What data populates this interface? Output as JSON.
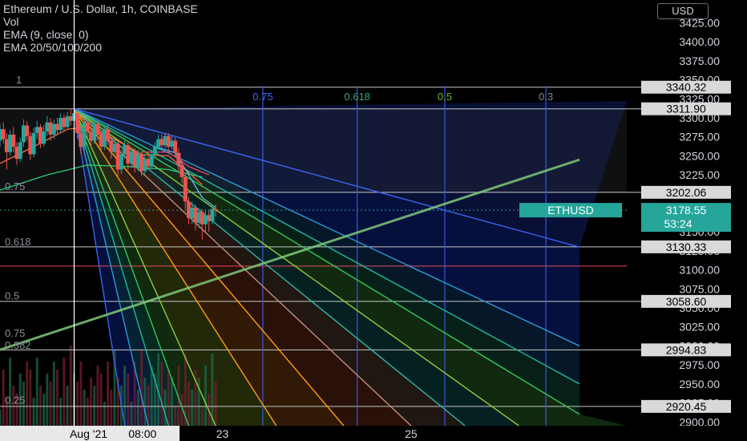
{
  "chart_data": {
    "type": "candlestick",
    "title": "Ethereum / U.S. Dollar, 1h, COINBASE",
    "indicators": [
      "Vol",
      "EMA (9, close, 0)",
      "EMA 20/50/100/200"
    ],
    "currency_button": "USD",
    "ylim": [
      2895,
      3455
    ],
    "y_ticks": [
      3425,
      3400,
      3375,
      3350,
      3325,
      3300,
      3275,
      3250,
      3225,
      3200,
      3175,
      3150,
      3125,
      3100,
      3075,
      3050,
      3025,
      3000,
      2975,
      2950,
      2925,
      2900
    ],
    "y_tick_labels": [
      "3425.00",
      "3400.00",
      "3375.00",
      "3350.00",
      "3325.00",
      "3300.00",
      "3275.00",
      "3250.00",
      "3225.00",
      "3200.00",
      "3175.00",
      "3150.00",
      "3125.00",
      "3100.00",
      "3075.00",
      "3050.00",
      "3025.00",
      "3000.00",
      "2975.00",
      "2950.00",
      "2925.00",
      "2900.00"
    ],
    "x_labels": [
      {
        "label": "Aug '21",
        "hour": 0,
        "highlight": true
      },
      {
        "label": "08:00",
        "hour": 8,
        "highlight": true
      },
      {
        "label": "23",
        "hour": 22
      },
      {
        "label": "25",
        "hour": 50
      }
    ],
    "x_range_hours": [
      -11,
      82
    ],
    "price_label": {
      "symbol": "ETHUSD",
      "price": "3178.55",
      "countdown": "53:24",
      "value": 3178.55
    },
    "horizontal_levels": [
      {
        "value": 3340.32,
        "label": "3340.32"
      },
      {
        "value": 3311.9,
        "label": "3311.90"
      },
      {
        "value": 3202.06,
        "label": "3202.06"
      },
      {
        "value": 3130.33,
        "label": "3130.33"
      },
      {
        "value": 3058.6,
        "label": "3058.60"
      },
      {
        "value": 2994.83,
        "label": "2994.83"
      },
      {
        "value": 2920.45,
        "label": "2920.45"
      }
    ],
    "red_level": 3105,
    "fib_time_labels": [
      {
        "label": "0.75",
        "hour": 28,
        "color": "#3b6ef5"
      },
      {
        "label": "0.618",
        "hour": 42,
        "color": "#2fa87a"
      },
      {
        "label": "0.5",
        "hour": 55,
        "color": "#6fb83a"
      },
      {
        "label": "0.3",
        "hour": 70,
        "color": "#7f8c8d"
      }
    ],
    "fib_price_labels": [
      {
        "label": "1",
        "value": 3342
      },
      {
        "label": "0.75",
        "value": 3202
      },
      {
        "label": "0.618",
        "value": 3129
      },
      {
        "label": "0.5",
        "value": 3058
      },
      {
        "label": "0.75",
        "value": 3009
      },
      {
        "label": "0.382",
        "value": 2993
      },
      {
        "label": "0.25",
        "value": 2921
      }
    ],
    "fan_origin": {
      "hour": 0,
      "value": 3311.9
    },
    "fan_lines": [
      {
        "end_hour": 7.5,
        "end_value": 2895,
        "color": "#3a63f0"
      },
      {
        "end_hour": 11,
        "end_value": 2895,
        "color": "#2a9bd8"
      },
      {
        "end_hour": 14,
        "end_value": 2895,
        "color": "#1fb8a0"
      },
      {
        "end_hour": 17,
        "end_value": 2895,
        "color": "#34c759"
      },
      {
        "end_hour": 21,
        "end_value": 2895,
        "color": "#8fce3a"
      },
      {
        "end_hour": 30,
        "end_value": 2895,
        "color": "#ff9f0a"
      },
      {
        "end_hour": 40,
        "end_value": 2895,
        "color": "#ff9f0a"
      },
      {
        "end_hour": 50,
        "end_value": 2895,
        "color": "#bf8f7a"
      },
      {
        "end_hour": 58,
        "end_value": 2895,
        "color": "#2fb8a8"
      },
      {
        "end_hour": 66,
        "end_value": 2895,
        "color": "#8fce3a"
      },
      {
        "end_hour": 75,
        "end_value": 2910,
        "color": "#34c759"
      },
      {
        "end_hour": 75,
        "end_value": 2950,
        "color": "#1fb8a0"
      },
      {
        "end_hour": 75,
        "end_value": 3000,
        "color": "#2a9bd8"
      },
      {
        "end_hour": 75,
        "end_value": 3130,
        "color": "#3a63f0"
      }
    ],
    "trend_line": {
      "start_hour": -11,
      "start_value": 2995,
      "end_hour": 75,
      "end_value": 3245,
      "color": "#7ec87a"
    },
    "candles": [
      {
        "h": -11,
        "o": 3270,
        "c": 3285,
        "hi": 3292,
        "lo": 3262
      },
      {
        "h": -10.5,
        "o": 3285,
        "c": 3272,
        "hi": 3294,
        "lo": 3266
      },
      {
        "h": -10,
        "o": 3272,
        "c": 3255,
        "hi": 3280,
        "lo": 3232
      },
      {
        "h": -9.5,
        "o": 3255,
        "c": 3278,
        "hi": 3284,
        "lo": 3250
      },
      {
        "h": -9,
        "o": 3278,
        "c": 3262,
        "hi": 3288,
        "lo": 3255
      },
      {
        "h": -8.5,
        "o": 3262,
        "c": 3246,
        "hi": 3268,
        "lo": 3238
      },
      {
        "h": -8,
        "o": 3246,
        "c": 3268,
        "hi": 3274,
        "lo": 3242
      },
      {
        "h": -7.5,
        "o": 3268,
        "c": 3290,
        "hi": 3298,
        "lo": 3262
      },
      {
        "h": -7,
        "o": 3290,
        "c": 3276,
        "hi": 3296,
        "lo": 3270
      },
      {
        "h": -6.5,
        "o": 3276,
        "c": 3252,
        "hi": 3282,
        "lo": 3245
      },
      {
        "h": -6,
        "o": 3252,
        "c": 3280,
        "hi": 3287,
        "lo": 3248
      },
      {
        "h": -5.5,
        "o": 3280,
        "c": 3288,
        "hi": 3296,
        "lo": 3272
      },
      {
        "h": -5,
        "o": 3288,
        "c": 3266,
        "hi": 3292,
        "lo": 3260
      },
      {
        "h": -4.5,
        "o": 3266,
        "c": 3282,
        "hi": 3290,
        "lo": 3262
      },
      {
        "h": -4,
        "o": 3282,
        "c": 3294,
        "hi": 3302,
        "lo": 3276
      },
      {
        "h": -3.5,
        "o": 3294,
        "c": 3278,
        "hi": 3300,
        "lo": 3270
      },
      {
        "h": -3,
        "o": 3278,
        "c": 3292,
        "hi": 3298,
        "lo": 3272
      },
      {
        "h": -2.5,
        "o": 3292,
        "c": 3284,
        "hi": 3300,
        "lo": 3278
      },
      {
        "h": -2,
        "o": 3284,
        "c": 3300,
        "hi": 3306,
        "lo": 3280
      },
      {
        "h": -1.5,
        "o": 3300,
        "c": 3288,
        "hi": 3305,
        "lo": 3282
      },
      {
        "h": -1,
        "o": 3288,
        "c": 3302,
        "hi": 3308,
        "lo": 3284
      },
      {
        "h": -0.5,
        "o": 3302,
        "c": 3296,
        "hi": 3312,
        "lo": 3290
      },
      {
        "h": 0,
        "o": 3296,
        "c": 3306,
        "hi": 3312,
        "lo": 3288
      },
      {
        "h": 0.5,
        "o": 3306,
        "c": 3280,
        "hi": 3310,
        "lo": 3272
      },
      {
        "h": 1,
        "o": 3280,
        "c": 3262,
        "hi": 3288,
        "lo": 3252
      },
      {
        "h": 1.5,
        "o": 3262,
        "c": 3294,
        "hi": 3300,
        "lo": 3256
      },
      {
        "h": 2,
        "o": 3294,
        "c": 3282,
        "hi": 3302,
        "lo": 3275
      },
      {
        "h": 2.5,
        "o": 3282,
        "c": 3270,
        "hi": 3290,
        "lo": 3262
      },
      {
        "h": 3,
        "o": 3270,
        "c": 3292,
        "hi": 3298,
        "lo": 3266
      },
      {
        "h": 3.5,
        "o": 3292,
        "c": 3278,
        "hi": 3296,
        "lo": 3270
      },
      {
        "h": 4,
        "o": 3278,
        "c": 3262,
        "hi": 3284,
        "lo": 3255
      },
      {
        "h": 4.5,
        "o": 3262,
        "c": 3285,
        "hi": 3290,
        "lo": 3258
      },
      {
        "h": 5,
        "o": 3285,
        "c": 3270,
        "hi": 3292,
        "lo": 3264
      },
      {
        "h": 5.5,
        "o": 3270,
        "c": 3255,
        "hi": 3276,
        "lo": 3246
      },
      {
        "h": 6,
        "o": 3255,
        "c": 3266,
        "hi": 3272,
        "lo": 3250
      },
      {
        "h": 6.5,
        "o": 3266,
        "c": 3232,
        "hi": 3270,
        "lo": 3222
      },
      {
        "h": 7,
        "o": 3232,
        "c": 3252,
        "hi": 3258,
        "lo": 3226
      },
      {
        "h": 7.5,
        "o": 3252,
        "c": 3264,
        "hi": 3270,
        "lo": 3246
      },
      {
        "h": 8,
        "o": 3264,
        "c": 3240,
        "hi": 3268,
        "lo": 3232
      },
      {
        "h": 8.5,
        "o": 3240,
        "c": 3256,
        "hi": 3262,
        "lo": 3234
      },
      {
        "h": 9,
        "o": 3256,
        "c": 3236,
        "hi": 3260,
        "lo": 3228
      },
      {
        "h": 9.5,
        "o": 3236,
        "c": 3252,
        "hi": 3258,
        "lo": 3230
      },
      {
        "h": 10,
        "o": 3252,
        "c": 3230,
        "hi": 3256,
        "lo": 3224
      },
      {
        "h": 10.5,
        "o": 3230,
        "c": 3246,
        "hi": 3252,
        "lo": 3226
      },
      {
        "h": 11,
        "o": 3246,
        "c": 3236,
        "hi": 3252,
        "lo": 3232
      },
      {
        "h": 11.5,
        "o": 3236,
        "c": 3252,
        "hi": 3258,
        "lo": 3232
      },
      {
        "h": 12,
        "o": 3252,
        "c": 3262,
        "hi": 3268,
        "lo": 3248
      },
      {
        "h": 12.5,
        "o": 3262,
        "c": 3272,
        "hi": 3278,
        "lo": 3258
      },
      {
        "h": 13,
        "o": 3272,
        "c": 3264,
        "hi": 3278,
        "lo": 3258
      },
      {
        "h": 13.5,
        "o": 3264,
        "c": 3276,
        "hi": 3280,
        "lo": 3260
      },
      {
        "h": 14,
        "o": 3276,
        "c": 3262,
        "hi": 3280,
        "lo": 3256
      },
      {
        "h": 14.5,
        "o": 3262,
        "c": 3270,
        "hi": 3276,
        "lo": 3258
      },
      {
        "h": 15,
        "o": 3270,
        "c": 3254,
        "hi": 3274,
        "lo": 3248
      },
      {
        "h": 15.5,
        "o": 3254,
        "c": 3238,
        "hi": 3260,
        "lo": 3230
      },
      {
        "h": 16,
        "o": 3238,
        "c": 3222,
        "hi": 3244,
        "lo": 3214
      },
      {
        "h": 16.5,
        "o": 3222,
        "c": 3190,
        "hi": 3228,
        "lo": 3180
      },
      {
        "h": 17,
        "o": 3190,
        "c": 3168,
        "hi": 3196,
        "lo": 3160
      },
      {
        "h": 17.5,
        "o": 3168,
        "c": 3182,
        "hi": 3190,
        "lo": 3160
      },
      {
        "h": 18,
        "o": 3182,
        "c": 3162,
        "hi": 3186,
        "lo": 3152
      },
      {
        "h": 18.5,
        "o": 3162,
        "c": 3176,
        "hi": 3182,
        "lo": 3155
      },
      {
        "h": 19,
        "o": 3176,
        "c": 3160,
        "hi": 3180,
        "lo": 3140
      },
      {
        "h": 19.5,
        "o": 3160,
        "c": 3172,
        "hi": 3178,
        "lo": 3148
      },
      {
        "h": 20,
        "o": 3172,
        "c": 3164,
        "hi": 3178,
        "lo": 3150
      },
      {
        "h": 20.5,
        "o": 3164,
        "c": 3180,
        "hi": 3186,
        "lo": 3160
      },
      {
        "h": 21,
        "o": 3180,
        "c": 3178.55,
        "hi": 3186,
        "lo": 3170
      }
    ],
    "ema_lines": [
      {
        "color": "#ff6b35",
        "points": [
          [
            -11,
            3240
          ],
          [
            -6,
            3262
          ],
          [
            -1,
            3285
          ],
          [
            2,
            3288
          ],
          [
            6,
            3272
          ],
          [
            10,
            3252
          ],
          [
            14,
            3250
          ],
          [
            17,
            3228
          ],
          [
            19,
            3212
          ]
        ]
      },
      {
        "color": "#2ecc71",
        "points": [
          [
            -11,
            3205
          ],
          [
            -4,
            3225
          ],
          [
            2,
            3238
          ],
          [
            8,
            3236
          ],
          [
            14,
            3232
          ],
          [
            19,
            3222
          ]
        ]
      },
      {
        "color": "#e84a5f",
        "points": [
          [
            10,
            3255
          ],
          [
            14,
            3255
          ],
          [
            17,
            3236
          ],
          [
            20,
            3225
          ]
        ]
      },
      {
        "color": "#4fc3f7",
        "points": [
          [
            12,
            3262
          ],
          [
            15,
            3254
          ],
          [
            17,
            3225
          ],
          [
            19,
            3195
          ],
          [
            21,
            3182
          ]
        ]
      }
    ]
  }
}
